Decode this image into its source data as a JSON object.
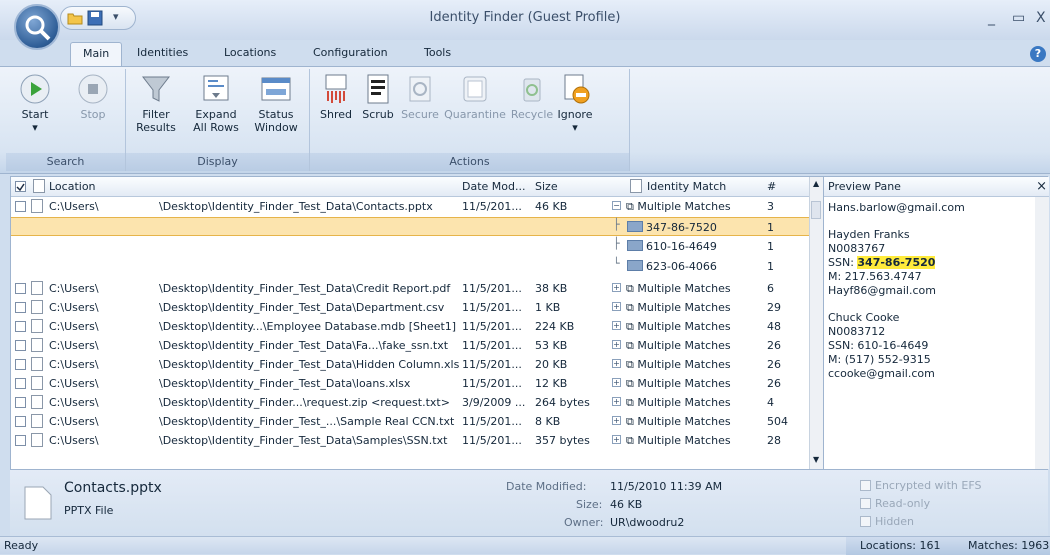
{
  "window": {
    "title": "Identity Finder (Guest Profile)",
    "minimize": "_",
    "maximize": "▭",
    "close": "X"
  },
  "tabs": [
    "Main",
    "Identities",
    "Locations",
    "Configuration",
    "Tools"
  ],
  "help": "?",
  "ribbon": {
    "groups": {
      "search": "Search",
      "display": "Display",
      "actions": "Actions"
    },
    "buttons": {
      "start": "Start",
      "stop": "Stop",
      "filter": "Filter",
      "filter2": "Results",
      "expand": "Expand",
      "expand2": "All Rows",
      "status": "Status",
      "status2": "Window",
      "shred": "Shred",
      "scrub": "Scrub",
      "secure": "Secure",
      "quarantine": "Quarantine",
      "recycle": "Recycle",
      "ignore": "Ignore",
      "dropdown": "▾"
    }
  },
  "grid": {
    "headers": {
      "location": "Location",
      "date": "Date Mod...",
      "size": "Size",
      "identity": "Identity Match",
      "count": "#"
    },
    "first_row": {
      "loc": "C:\\Users\\",
      "path": "\\Desktop\\Identity_Finder_Test_Data\\Contacts.pptx",
      "date": "11/5/201...",
      "size": "46 KB",
      "match": "Multiple Matches",
      "count": "3"
    },
    "sub_rows": [
      {
        "match": "347-86-7520",
        "count": "1"
      },
      {
        "match": "610-16-4649",
        "count": "1"
      },
      {
        "match": "623-06-4066",
        "count": "1"
      }
    ],
    "rows": [
      {
        "loc": "C:\\Users\\",
        "path": "\\Desktop\\Identity_Finder_Test_Data\\Credit Report.pdf",
        "date": "11/5/201...",
        "size": "38 KB",
        "match": "Multiple Matches",
        "count": "6"
      },
      {
        "loc": "C:\\Users\\",
        "path": "\\Desktop\\Identity_Finder_Test_Data\\Department.csv",
        "date": "11/5/201...",
        "size": "1 KB",
        "match": "Multiple Matches",
        "count": "29"
      },
      {
        "loc": "C:\\Users\\",
        "path": "\\Desktop\\Identity...\\Employee Database.mdb [Sheet1]",
        "date": "11/5/201...",
        "size": "224 KB",
        "match": "Multiple Matches",
        "count": "48"
      },
      {
        "loc": "C:\\Users\\",
        "path": "\\Desktop\\Identity_Finder_Test_Data\\Fa...\\fake_ssn.txt",
        "date": "11/5/201...",
        "size": "53 KB",
        "match": "Multiple Matches",
        "count": "26"
      },
      {
        "loc": "C:\\Users\\",
        "path": "\\Desktop\\Identity_Finder_Test_Data\\Hidden Column.xls",
        "date": "11/5/201...",
        "size": "20 KB",
        "match": "Multiple Matches",
        "count": "26"
      },
      {
        "loc": "C:\\Users\\",
        "path": "\\Desktop\\Identity_Finder_Test_Data\\loans.xlsx",
        "date": "11/5/201...",
        "size": "12 KB",
        "match": "Multiple Matches",
        "count": "26"
      },
      {
        "loc": "C:\\Users\\",
        "path": "\\Desktop\\Identity_Finder...\\request.zip <request.txt>",
        "date": "3/9/2009 ...",
        "size": "264 bytes",
        "match": "Multiple Matches",
        "count": "4"
      },
      {
        "loc": "C:\\Users\\",
        "path": "\\Desktop\\Identity_Finder_Test_...\\Sample Real CCN.txt",
        "date": "11/5/201...",
        "size": "8 KB",
        "match": "Multiple Matches",
        "count": "504"
      },
      {
        "loc": "C:\\Users\\",
        "path": "\\Desktop\\Identity_Finder_Test_Data\\Samples\\SSN.txt",
        "date": "11/5/201...",
        "size": "357 bytes",
        "match": "Multiple Matches",
        "count": "28"
      }
    ]
  },
  "preview": {
    "title": "Preview Pane",
    "close": "×",
    "l1": "Hans.barlow@gmail.com",
    "l2": "Hayden Franks",
    "l3": "N0083767",
    "l4a": "SSN: ",
    "l4b": "347-86-7520",
    "l5": "M: 217.563.4747",
    "l6": "Hayf86@gmail.com",
    "l7": "Chuck Cooke",
    "l8": "N0083712",
    "l9": "SSN: 610-16-4649",
    "l10": "M: (517) 552-9315",
    "l11": "ccooke@gmail.com"
  },
  "info": {
    "filename": "Contacts.pptx",
    "filetype": "PPTX File",
    "modified_label": "Date Modified:",
    "modified": "11/5/2010 11:39 AM",
    "size_label": "Size:",
    "size": "46 KB",
    "owner_label": "Owner:",
    "owner": "UR\\dwoodru2",
    "encrypted": "Encrypted with EFS",
    "readonly": "Read-only",
    "hidden": "Hidden"
  },
  "status": {
    "ready": "Ready",
    "locations": "Locations: 161",
    "matches": "Matches: 1963"
  }
}
